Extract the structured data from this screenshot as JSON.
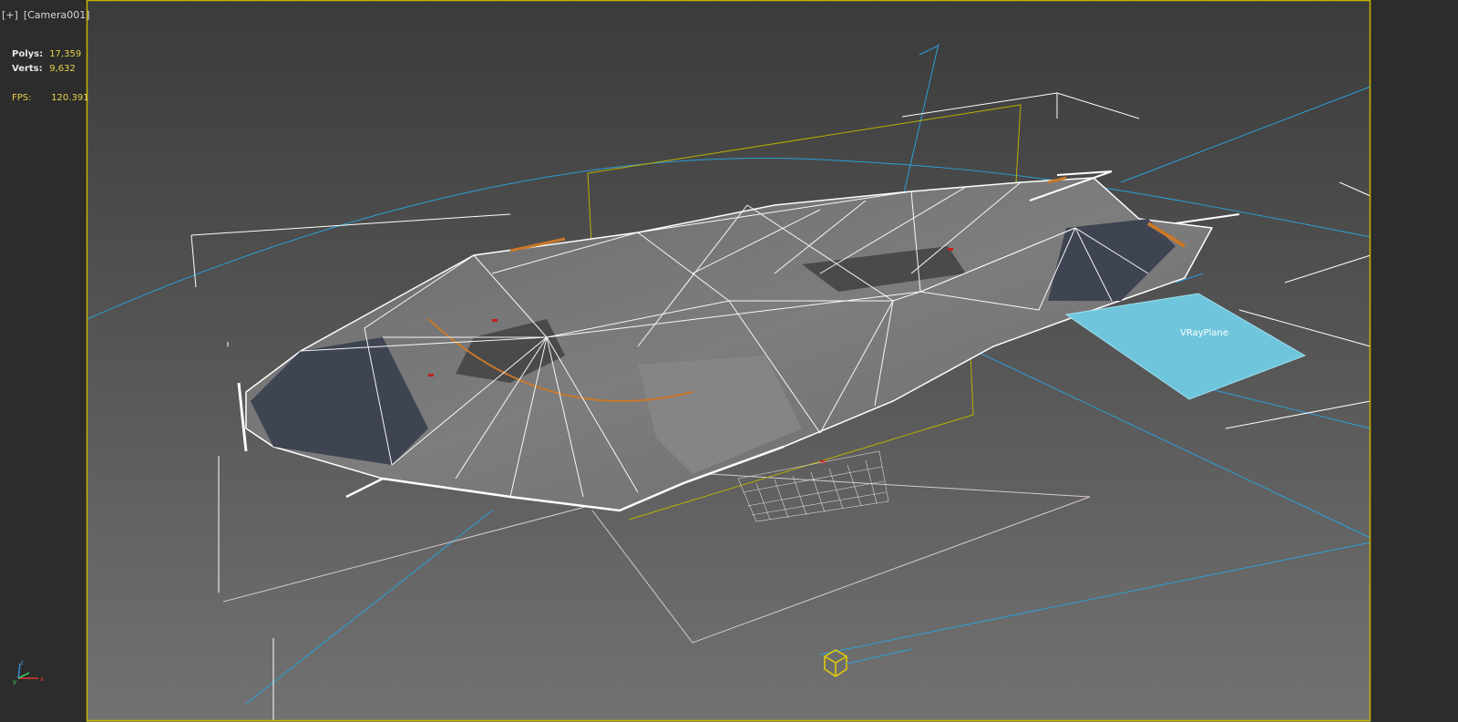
{
  "viewport": {
    "menu_plus": "[+]",
    "camera_name": "[Camera001]"
  },
  "stats": {
    "polys_label": "Polys:",
    "polys_value": "17,359",
    "verts_label": "Verts:",
    "verts_value": "9,632",
    "fps_label": "FPS:",
    "fps_value": "120.391"
  },
  "scene": {
    "plane_label": "VRayPlane",
    "axis_labels": {
      "x": "x",
      "y": "y",
      "z": "z"
    }
  },
  "colors": {
    "viewport_bg_top": "#3a3a3a",
    "viewport_bg_bottom": "#6e6e6e",
    "active_border": "#c8b400",
    "stat_value": "#e8d24a",
    "wireframe": "#ffffff",
    "vray_plane": "#6fc6dc",
    "camera_target": "#e6d000",
    "light_lines": "#2aa0d8"
  }
}
